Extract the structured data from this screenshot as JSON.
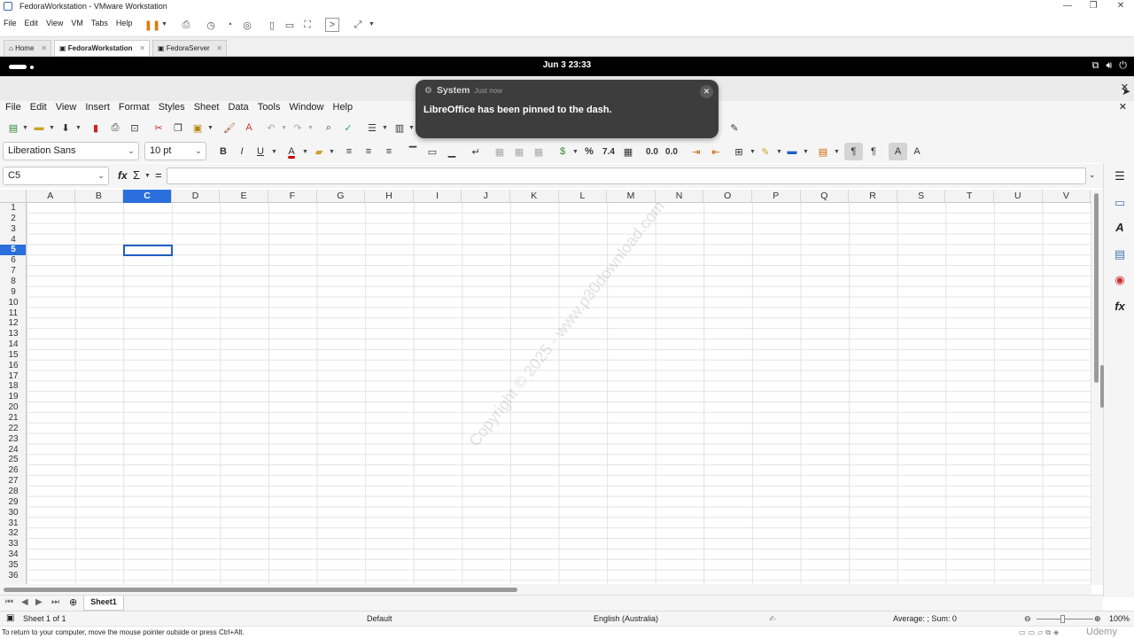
{
  "vmware": {
    "window_title": "FedoraWorkstation - VMware Workstation",
    "menu": [
      "File",
      "Edit",
      "View",
      "VM",
      "Tabs",
      "Help"
    ],
    "tabs": [
      {
        "label": "Home"
      },
      {
        "label": "FedoraWorkstation"
      },
      {
        "label": "FedoraServer"
      }
    ],
    "status_hint": "To return to your computer, move the mouse pointer outside or press Ctrl+Alt."
  },
  "gnome": {
    "clock": "Jun 3  23:33"
  },
  "notification": {
    "app": "System",
    "time": "Just now",
    "message": "LibreOffice has been pinned to the dash."
  },
  "libreoffice": {
    "menu": [
      "File",
      "Edit",
      "View",
      "Insert",
      "Format",
      "Styles",
      "Sheet",
      "Data",
      "Tools",
      "Window",
      "Help"
    ],
    "font_name": "Liberation Sans",
    "font_size": "10 pt",
    "name_box": "C5",
    "formula": "",
    "formula_icons": {
      "fx": "fx",
      "sum": "Σ",
      "equals": "="
    },
    "columns": [
      "A",
      "B",
      "C",
      "D",
      "E",
      "F",
      "G",
      "H",
      "I",
      "J",
      "K",
      "L",
      "M",
      "N",
      "O",
      "P",
      "Q",
      "R",
      "S",
      "T",
      "U",
      "V"
    ],
    "rows": [
      "1",
      "2",
      "3",
      "4",
      "5",
      "6",
      "7",
      "8",
      "9",
      "10",
      "11",
      "12",
      "13",
      "14",
      "15",
      "16",
      "17",
      "18",
      "19",
      "20",
      "21",
      "22",
      "23",
      "24",
      "25",
      "26",
      "27",
      "28",
      "29",
      "30",
      "31",
      "32",
      "33",
      "34",
      "35",
      "36"
    ],
    "selected_column": "C",
    "selected_row": "5",
    "sheet_tab": "Sheet1",
    "status": {
      "sheet": "Sheet 1 of 1",
      "page_style": "Default",
      "language": "English (Australia)",
      "summary": "Average: ; Sum: 0",
      "zoom": "100%"
    },
    "number_buttons": {
      "percent": "%",
      "number": "7.4",
      "add_decimal": "0.0",
      "del_decimal": "0.0"
    }
  },
  "watermark": "Copyright © 2025 - www.p30download.com",
  "udemy": "Udemy"
}
